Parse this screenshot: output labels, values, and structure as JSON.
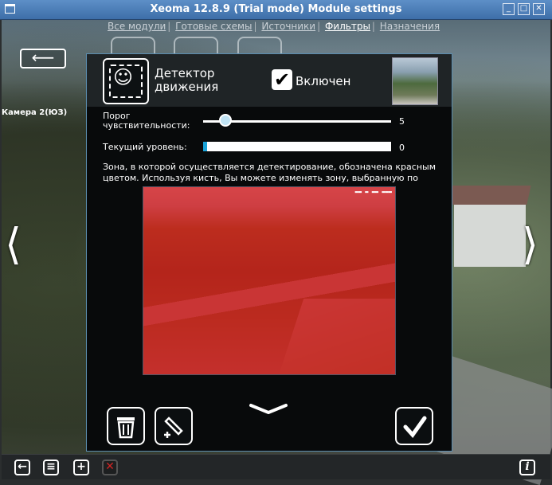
{
  "window": {
    "title": "Xeoma 12.8.9 (Trial mode) Module settings",
    "controls": [
      "minimize",
      "maximize",
      "close"
    ]
  },
  "tabs": [
    {
      "label": "Все модули",
      "active": false
    },
    {
      "label": "Готовые схемы",
      "active": false
    },
    {
      "label": "Источники",
      "active": false
    },
    {
      "label": "Фильтры",
      "active": true
    },
    {
      "label": "Назначения",
      "active": false
    }
  ],
  "camera_label": "Камера 2(ЮЗ)",
  "filter": {
    "title_line1": "Детектор",
    "title_line2": "движения",
    "enabled_label": "Включен",
    "enabled": true
  },
  "sensitivity": {
    "label_line1": "Порог",
    "label_line2": "чувствительности:",
    "value": "5",
    "fraction": 0.12
  },
  "current_level": {
    "label": "Текущий уровень:",
    "value": "0",
    "fraction": 0.02
  },
  "description": "Зона, в которой осуществляется детектирование, обозначена красным цветом. Используя кисть, Вы можете изменять зону, выбранную по",
  "colors": {
    "accent": "#1aa3d9",
    "zone": "#e21414",
    "titlebar": "#4a7cb8"
  },
  "icons": {
    "back": "back-arrow-icon",
    "prev": "chevron-left-icon",
    "next": "chevron-right-icon",
    "delete": "trash-icon",
    "settings": "wrench-add-icon",
    "confirm": "checkmark-icon",
    "info": "info-icon"
  },
  "bottom_bar": {
    "info_label": "i"
  }
}
